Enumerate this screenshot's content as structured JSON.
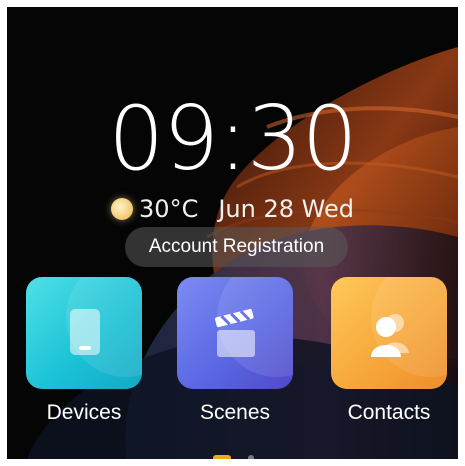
{
  "status": {
    "time": "09:30",
    "temperature": "30°C",
    "date": "Jun 28 Wed",
    "weather_icon": "sun-icon"
  },
  "account_button": {
    "label": "Account Registration"
  },
  "tiles": [
    {
      "label": "Devices",
      "icon": "phone-icon",
      "color": "#1cc3d6"
    },
    {
      "label": "Scenes",
      "icon": "clapperboard-icon",
      "color": "#5a68e4"
    },
    {
      "label": "Contacts",
      "icon": "contacts-icon",
      "color": "#f7a83a"
    }
  ],
  "pagination": {
    "active_color": "#f5a623",
    "pages": 2,
    "current": 1
  }
}
